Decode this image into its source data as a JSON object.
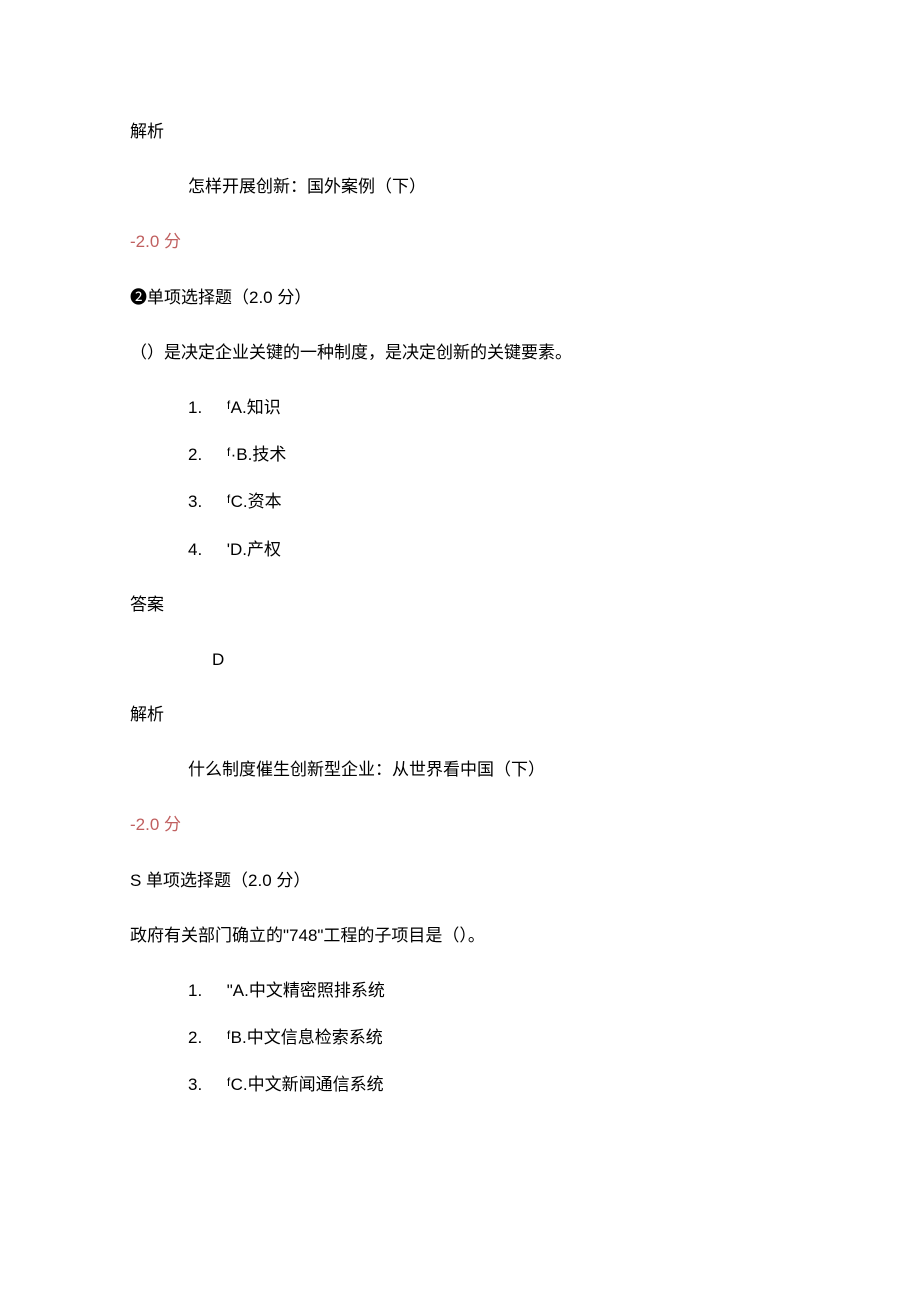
{
  "section1": {
    "analysis_label": "解析",
    "analysis_text": "怎样开展创新：国外案例（下）",
    "score_text": "-2.0 分"
  },
  "question1": {
    "heading": "❷单项选择题（2.0 分）",
    "stem": "（）是决定企业关键的一种制度，是决定创新的关键要素。",
    "options": [
      {
        "num": "1.",
        "text": "ᶠA.知识"
      },
      {
        "num": "2.",
        "text": "ᶠ·B.技术"
      },
      {
        "num": "3.",
        "text": "ᶠC.资本"
      },
      {
        "num": "4.",
        "text": "'D.产权"
      }
    ],
    "answer_label": "答案",
    "answer_value": "D",
    "analysis_label": "解析",
    "analysis_text": "什么制度催生创新型企业：从世界看中国（下）",
    "score_text": "-2.0 分"
  },
  "question2": {
    "heading": "S 单项选择题（2.0 分）",
    "stem": "政府有关部门确立的\"748\"工程的子项目是（）。",
    "options": [
      {
        "num": "1.",
        "text": "\"A.中文精密照排系统"
      },
      {
        "num": "2.",
        "text": "ᶠB.中文信息检索系统"
      },
      {
        "num": "3.",
        "text": "ᶠC.中文新闻通信系统"
      }
    ]
  }
}
